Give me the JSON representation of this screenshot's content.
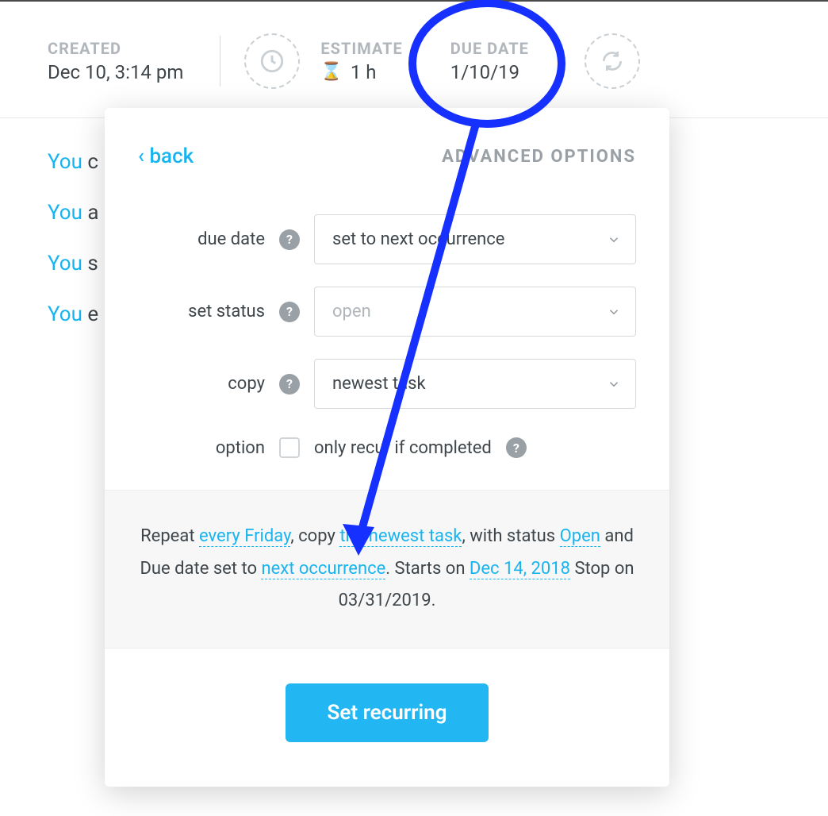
{
  "header": {
    "created": {
      "label": "CREATED",
      "value": "Dec 10, 3:14 pm"
    },
    "estimate": {
      "label": "ESTIMATE",
      "value": "1 h"
    },
    "due_date": {
      "label": "DUE DATE",
      "value": "1/10/19"
    }
  },
  "activity": {
    "you": "You",
    "lines": [
      "c",
      "a",
      "s",
      "e"
    ]
  },
  "panel": {
    "back_label": "back",
    "title": "ADVANCED OPTIONS",
    "fields": {
      "due_date": {
        "label": "due date",
        "value": "set to next occurrence"
      },
      "set_status": {
        "label": "set status",
        "value": "open"
      },
      "copy": {
        "label": "copy",
        "value": "newest task"
      },
      "option": {
        "label": "option",
        "text": "only recur if completed"
      }
    },
    "summary": {
      "t1": "Repeat ",
      "link_freq": "every Friday",
      "t2": ", copy ",
      "link_copy": "the newest task",
      "t3": ", with status ",
      "link_status": "Open",
      "t4": " and Due date set to ",
      "link_due": "next occurrence",
      "t5": ". Starts on ",
      "link_start": "Dec 14, 2018",
      "t6": " Stop on 03/31/2019."
    },
    "submit_label": "Set recurring"
  }
}
